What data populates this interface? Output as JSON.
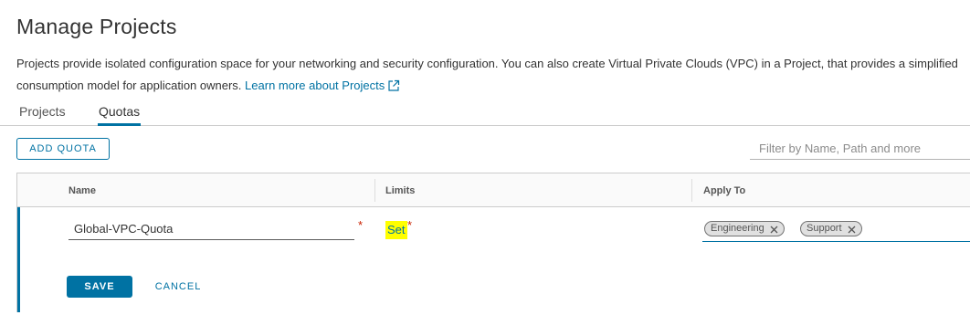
{
  "page": {
    "title": "Manage Projects",
    "description": "Projects provide isolated configuration space for your networking and security configuration. You can also create Virtual Private Clouds (VPC) in a Project, that provides a simplified consumption model for application owners.",
    "learn_more_label": "Learn more about Projects"
  },
  "tabs": [
    {
      "label": "Projects",
      "active": false
    },
    {
      "label": "Quotas",
      "active": true
    }
  ],
  "toolbar": {
    "add_quota_label": "ADD QUOTA",
    "filter_placeholder": "Filter by Name, Path and more"
  },
  "grid": {
    "columns": [
      "Name",
      "Limits",
      "Apply To"
    ],
    "edit_row": {
      "name_value": "Global-VPC-Quota",
      "limits_label": "Set",
      "required_marker": "*",
      "apply_to": [
        "Engineering",
        "Support"
      ],
      "save_label": "SAVE",
      "cancel_label": "CANCEL"
    }
  },
  "colors": {
    "accent": "#0072a3",
    "required": "#c92100",
    "highlight": "#ffff00",
    "chip_bg": "#e0e0e0"
  },
  "icons": {
    "external_link": "external-link-icon",
    "chip_remove": "close-icon"
  }
}
